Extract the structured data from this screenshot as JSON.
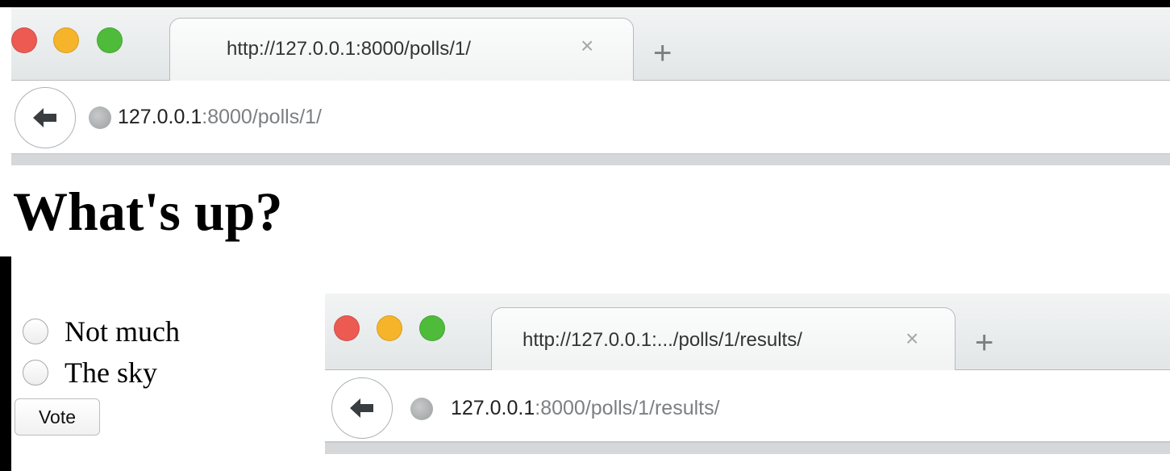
{
  "browser_top": {
    "tab_title": "http://127.0.0.1:8000/polls/1/",
    "url_host": "127.0.0.1",
    "url_rest": ":8000/polls/1/"
  },
  "page": {
    "question": "What's up?",
    "choices": [
      {
        "label": "Not much"
      },
      {
        "label": "The sky"
      }
    ],
    "vote_label": "Vote"
  },
  "browser_results": {
    "tab_title": "http://127.0.0.1:.../polls/1/results/",
    "url_host": "127.0.0.1",
    "url_rest": ":8000/polls/1/results/"
  },
  "icons": {
    "tab_close": "×",
    "new_tab": "+"
  },
  "colors": {
    "close_light": "#ec5a52",
    "minimize_light": "#f5b42a",
    "zoom_light": "#4fbb3b"
  }
}
